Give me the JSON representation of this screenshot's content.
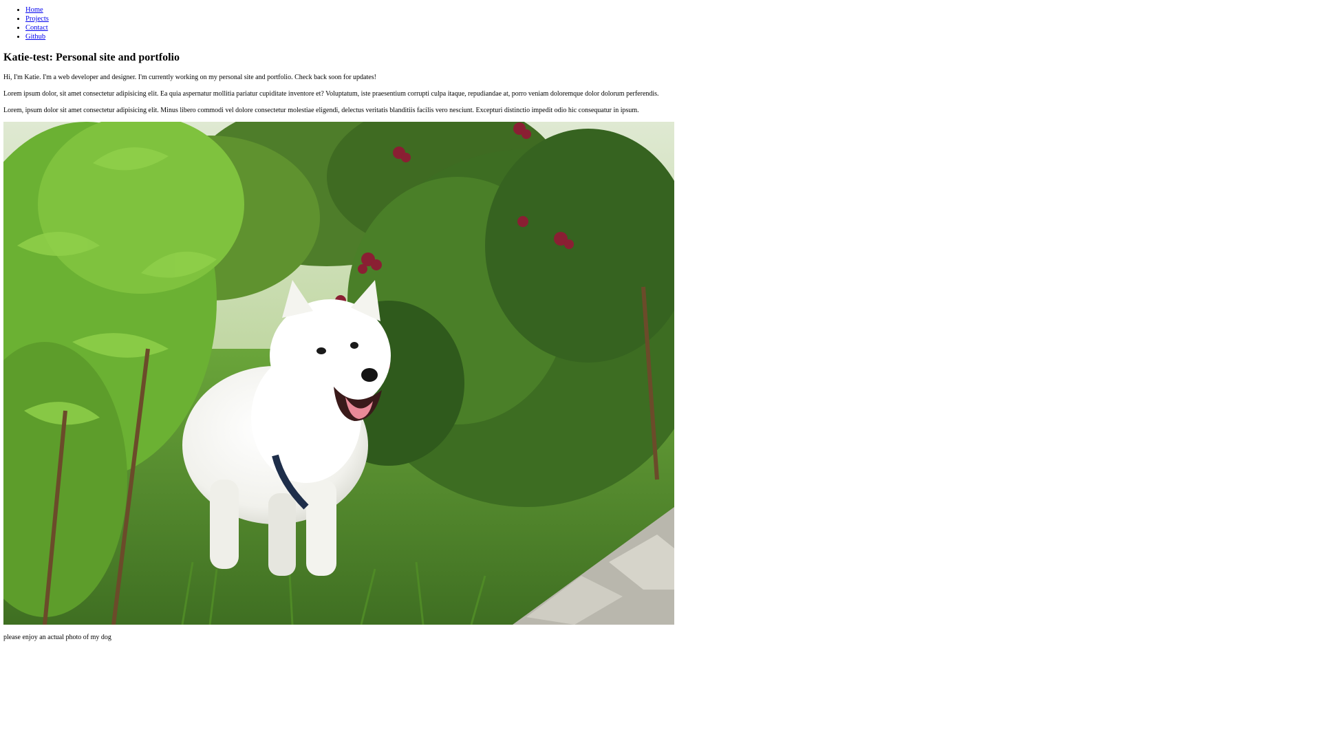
{
  "nav": {
    "items": [
      "Home",
      "Projects",
      "Contact",
      "Github"
    ]
  },
  "header": {
    "title": "Katie-test: Personal site and portfolio"
  },
  "main": {
    "paragraphs": [
      "Hi, I'm Katie. I'm a web developer and designer. I'm currently working on my personal site and portfolio. Check back soon for updates!",
      "Lorem ipsum dolor, sit amet consectetur adipisicing elit. Ea quia aspernatur mollitia pariatur cupiditate inventore et? Voluptatum, iste praesentium corrupti culpa itaque, repudiandae at, porro veniam doloremque dolor dolorum perferendis.",
      "Lorem, ipsum dolor sit amet consectetur adipisicing elit. Minus libero commodi vel dolore consectetur molestiae eligendi, delectus veritatis blanditiis facilis vero nesciunt. Excepturi distinctio impedit odio hic consequatur in ipsum."
    ],
    "caption": "please enjoy an actual photo of my dog"
  },
  "colors": {
    "link": "#0000ee",
    "text": "#000000",
    "background": "#ffffff"
  }
}
